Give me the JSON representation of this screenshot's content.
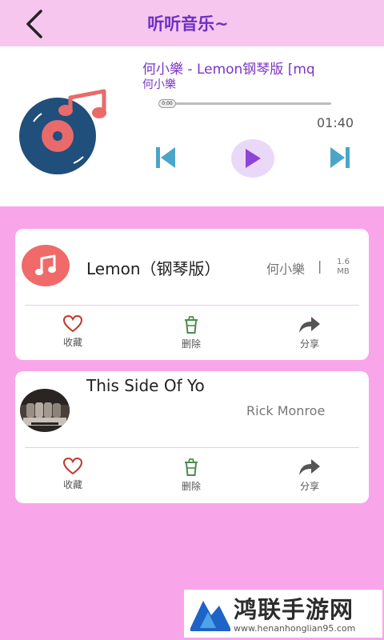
{
  "header": {
    "title": "听听音乐~"
  },
  "player": {
    "title": "何小樂 - Lemon钢琴版 [mq",
    "artist": "何小樂",
    "current_time": "0:00",
    "total_time": "01:40",
    "progress": 0.0
  },
  "songs": [
    {
      "title": "Lemon（钢琴版）",
      "artist": "何小樂",
      "separator": "|",
      "size_value": "1.6",
      "size_unit": "MB",
      "actions": {
        "favorite": "收藏",
        "delete": "删除",
        "share": "分享"
      }
    },
    {
      "title": "This Side Of Yo",
      "artist": "Rick Monroe",
      "actions": {
        "favorite": "收藏",
        "delete": "删除",
        "share": "分享"
      }
    }
  ],
  "watermark": {
    "name": "鸿联手游网",
    "url": "www.henanhonglian95.com"
  },
  "colors": {
    "header_bg": "#f7c6ef",
    "page_bg": "#f9a5ea",
    "accent": "#7b35c7",
    "player_controls": "#4aa6c9",
    "play_button": "#8e44d6"
  },
  "icons": [
    "back-arrow-icon",
    "vinyl-record-icon",
    "previous-track-icon",
    "play-icon",
    "next-track-icon",
    "music-note-icon",
    "heart-icon",
    "trash-icon",
    "share-arrow-icon"
  ]
}
